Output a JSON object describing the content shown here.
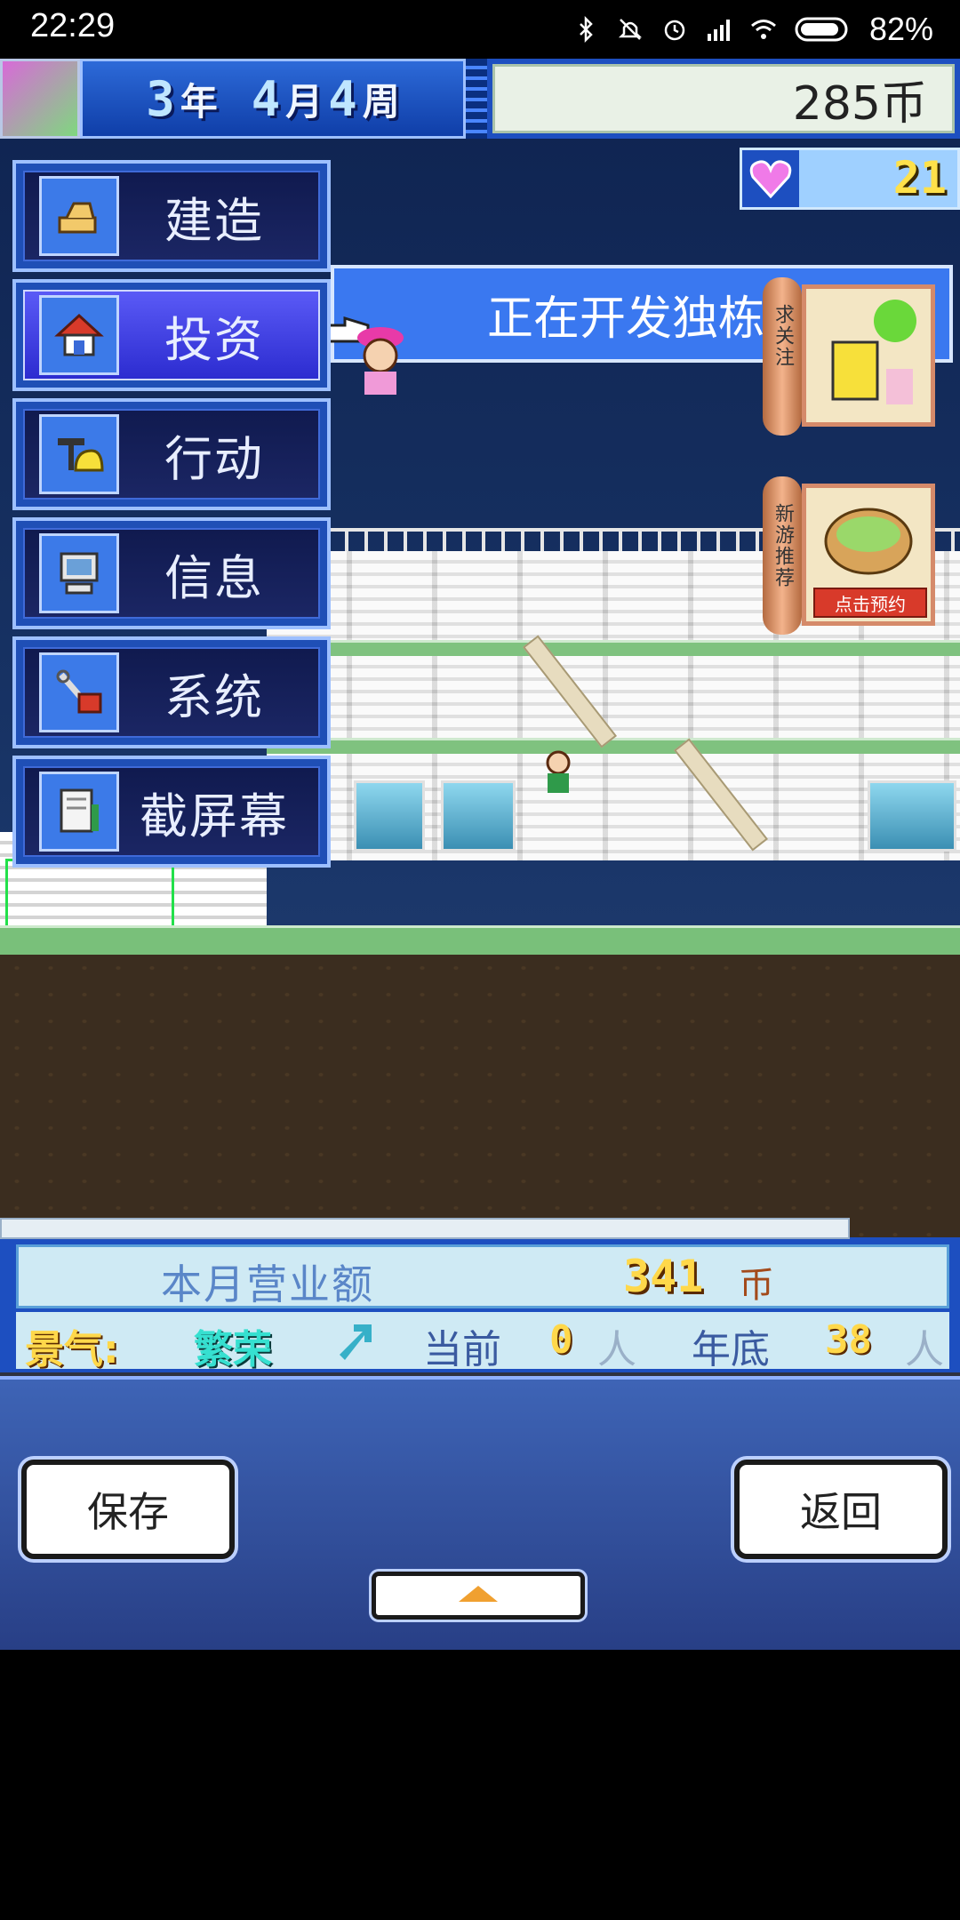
{
  "status_bar": {
    "time": "22:29",
    "battery": "82%"
  },
  "hud": {
    "year": "3",
    "year_unit": "年",
    "month": "4",
    "month_unit": "月",
    "week": "4",
    "week_unit": "周",
    "money": "285币",
    "hearts": "21"
  },
  "banner": {
    "text": "正在开发独栋"
  },
  "menu": [
    {
      "label": "建造",
      "icon": "build-icon"
    },
    {
      "label": "投资",
      "icon": "house-icon",
      "active": true
    },
    {
      "label": "行动",
      "icon": "hardhat-icon"
    },
    {
      "label": "信息",
      "icon": "computer-icon"
    },
    {
      "label": "系统",
      "icon": "tools-icon"
    },
    {
      "label": "截屏幕",
      "icon": "screenshot-icon"
    }
  ],
  "ads": [
    {
      "scroll_label": "求关注"
    },
    {
      "scroll_label": "新游推荐",
      "button": "点击预约"
    }
  ],
  "info": {
    "monthly_revenue_label": "本月营业额",
    "monthly_revenue_value": "341",
    "monthly_revenue_unit": "币",
    "mood_label": "景气:",
    "mood_value": "繁荣",
    "current_label": "当前",
    "current_value": "0",
    "current_unit": "人",
    "year_end_label": "年底",
    "year_end_value": "38",
    "year_end_unit": "人"
  },
  "buttons": {
    "save": "保存",
    "back": "返回"
  },
  "colors": {
    "menu_active": "#3c3ce8",
    "panel_blue": "#1d4fc0",
    "gold_text": "#ffd84a"
  }
}
